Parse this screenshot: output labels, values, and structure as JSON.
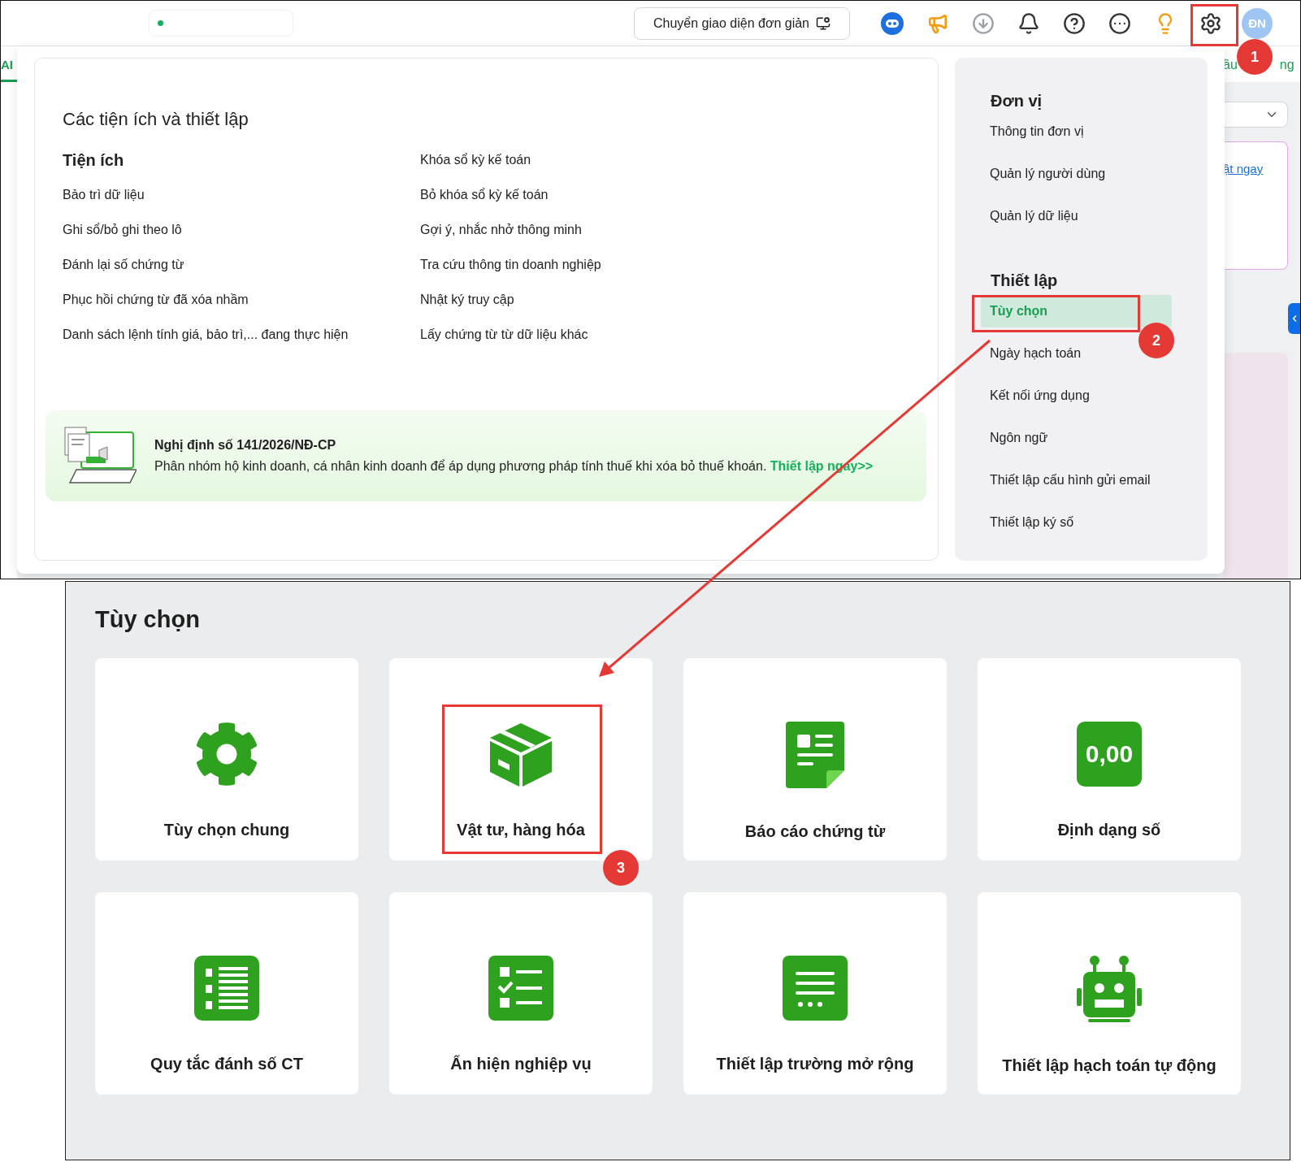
{
  "top_bar": {
    "simple_ui_button": "Chuyển giao diện đơn giản",
    "avatar": "ĐN"
  },
  "background": {
    "tab": "AI",
    "header_fragments": [
      "ầu",
      "ng"
    ],
    "card_link": "ật ngay"
  },
  "menu": {
    "title": "Các tiện ích và thiết lập",
    "utilities": {
      "heading": "Tiện ích",
      "columns": [
        [
          "Bảo trì dữ liệu",
          "Ghi sổ/bỏ ghi theo lô",
          "Đánh lại số chứng từ",
          "Phục hồi chứng từ đã xóa nhầm",
          "Danh sách lệnh tính giá, bảo trì,... đang thực hiện"
        ],
        [
          "Khóa sổ kỳ kế toán",
          "Bỏ khóa sổ kỳ kế toán",
          "Gợi ý, nhắc nhở thông minh",
          "Tra cứu thông tin doanh nghiệp",
          "Nhật ký truy cập",
          "Lấy chứng từ từ dữ liệu khác"
        ]
      ]
    },
    "notice": {
      "title": "Nghị định số 141/2026/NĐ-CP",
      "text": "Phân nhóm hộ kinh doanh, cá nhân kinh doanh để áp dụng phương pháp tính thuế khi xóa bỏ thuế khoán.",
      "link": "Thiết lập ngay>>"
    },
    "sections": [
      {
        "heading": "Đơn vị",
        "items": [
          {
            "label": "Thông tin đơn vị",
            "selected": false
          },
          {
            "label": "Quản lý người dùng",
            "selected": false
          },
          {
            "label": "Quản lý dữ liệu",
            "selected": false
          }
        ]
      },
      {
        "heading": "Thiết lập",
        "items": [
          {
            "label": "Tùy chọn",
            "selected": true
          },
          {
            "label": "Ngày hạch toán",
            "selected": false
          },
          {
            "label": "Kết nối ứng dụng",
            "selected": false
          },
          {
            "label": "Ngôn ngữ",
            "selected": false
          },
          {
            "label": "Thiết lập cấu hình gửi email",
            "selected": false
          },
          {
            "label": "Thiết lập ký số",
            "selected": false
          }
        ]
      }
    ]
  },
  "options_page": {
    "title": "Tùy chọn",
    "cards": [
      {
        "label": "Tùy chọn chung"
      },
      {
        "label": "Vật tư, hàng hóa"
      },
      {
        "label": "Báo cáo chứng từ"
      },
      {
        "label": "Định dạng số",
        "icon_text": "0,00"
      },
      {
        "label": "Quy tắc đánh số CT"
      },
      {
        "label": "Ẩn hiện nghiệp vụ"
      },
      {
        "label": "Thiết lập trường mở rộng"
      },
      {
        "label": "Thiết lập hạch toán tự động"
      }
    ]
  },
  "annotations": [
    {
      "label": "1"
    },
    {
      "label": "2"
    },
    {
      "label": "3"
    }
  ]
}
